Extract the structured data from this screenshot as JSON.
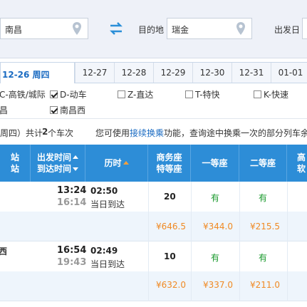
{
  "search": {
    "from_value": "南昌",
    "swap_icon": "swap-arrows-icon",
    "to_label": "目的地",
    "to_value": "瑞金",
    "date_label": "出发日"
  },
  "dates": {
    "active": "12-26 周四",
    "tabs": [
      "12-27",
      "12-28",
      "12-29",
      "12-30",
      "12-31",
      "01-01"
    ]
  },
  "filters": {
    "types": [
      {
        "label": "C-高铁/城际",
        "checked": null
      },
      {
        "label": "D-动车",
        "checked": true
      },
      {
        "label": "Z-直达",
        "checked": false
      },
      {
        "label": "T-特快",
        "checked": false
      },
      {
        "label": "K-快速",
        "checked": false
      }
    ],
    "stations": [
      {
        "label": "昌",
        "checked": null
      },
      {
        "label": "南昌西",
        "checked": true
      }
    ]
  },
  "summary": {
    "prefix": "周四）共计",
    "count": "2",
    "suffix": "个车次",
    "hint_pre": "您可使用",
    "hint_link": "接续换乘",
    "hint_post": "功能，查询途中换乘一次的部分列车余"
  },
  "table": {
    "headers": {
      "station_a": "站",
      "station_b": "站",
      "time_a": "出发时间",
      "time_b": "到达时间",
      "duration": "历时",
      "biz_a": "商务座",
      "biz_b": "特等座",
      "first": "一等座",
      "second": "二等座",
      "premium": "高",
      "premium_b": "软"
    },
    "trains": [
      {
        "station": "",
        "depart": "13:24",
        "arrive": "16:14",
        "duration": "02:50",
        "arrival_day": "当日到达",
        "business": "20",
        "first": "有",
        "second": "有",
        "price_business": "¥646.5",
        "price_first": "¥344.0",
        "price_second": "¥215.5"
      },
      {
        "station": "西",
        "depart": "16:54",
        "arrive": "19:43",
        "duration": "02:49",
        "arrival_day": "当日到达",
        "business": "10",
        "first": "有",
        "second": "有",
        "price_business": "¥632.0",
        "price_first": "¥337.0",
        "price_second": "¥211.0"
      }
    ]
  },
  "colors": {
    "header_blue": "#2d8dd7",
    "link_blue": "#1a6bc2",
    "available_green": "#1a9a2d",
    "price_orange": "#f08a24"
  }
}
